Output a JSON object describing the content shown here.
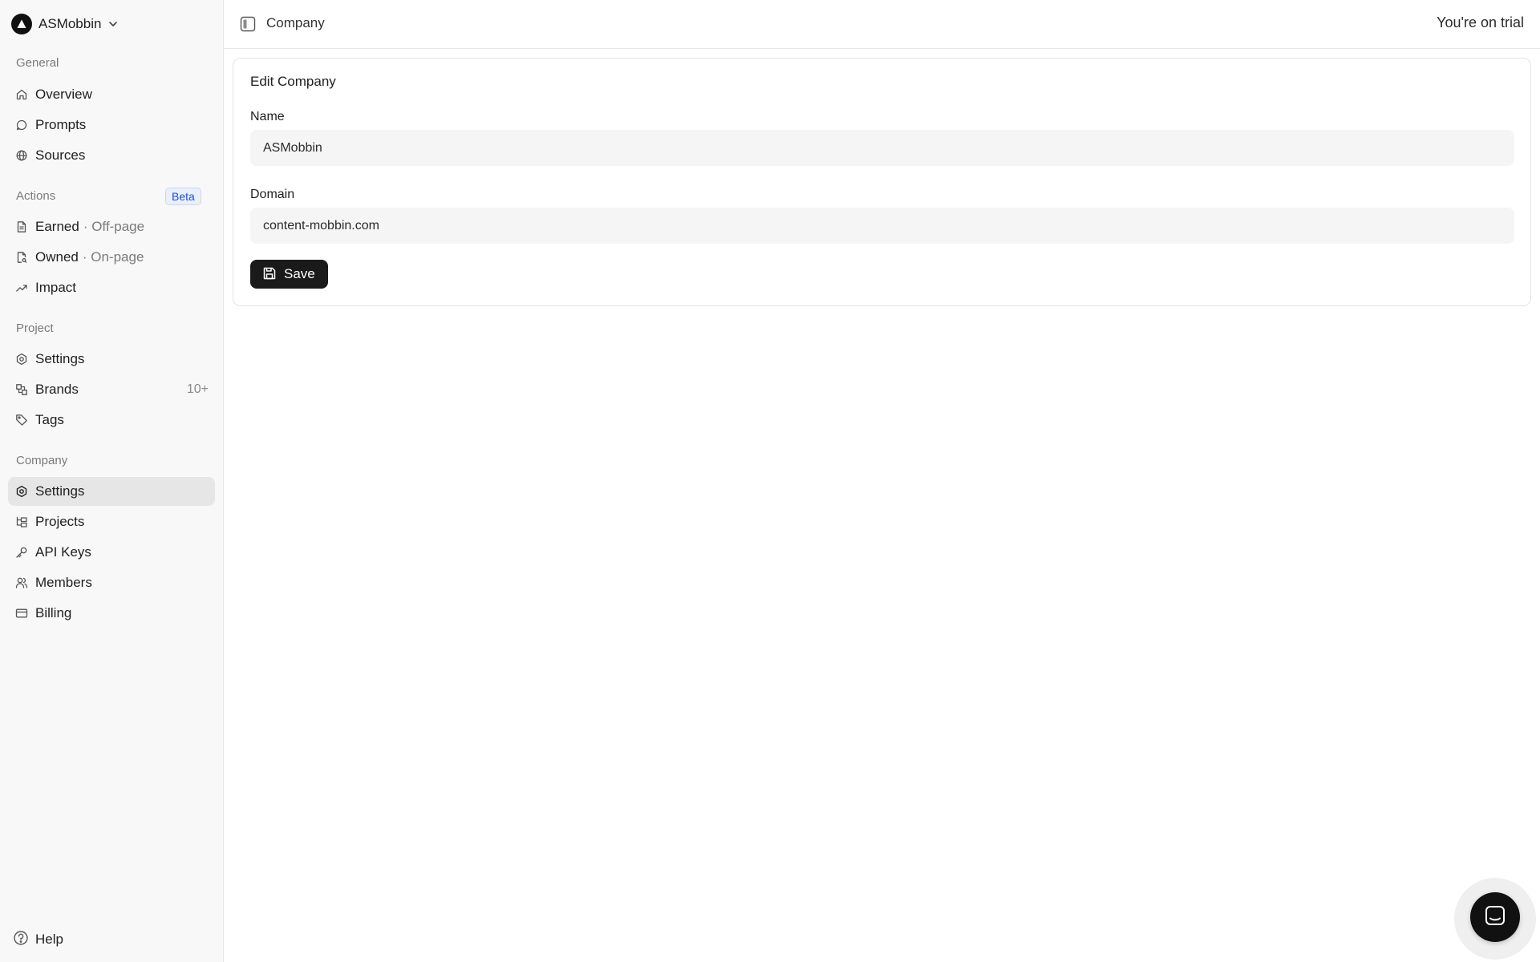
{
  "workspace": {
    "name": "ASMobbin"
  },
  "sidebar": {
    "groups": [
      {
        "label": "General",
        "items": [
          {
            "label": "Overview",
            "icon": "home-icon"
          },
          {
            "label": "Prompts",
            "icon": "message-circle-icon"
          },
          {
            "label": "Sources",
            "icon": "globe-icon"
          }
        ]
      },
      {
        "label": "Actions",
        "badge": "Beta",
        "items": [
          {
            "label": "Earned",
            "sub": "· Off-page",
            "icon": "file-text-icon"
          },
          {
            "label": "Owned",
            "sub": "· On-page",
            "icon": "file-search-icon"
          },
          {
            "label": "Impact",
            "icon": "trending-up-icon"
          }
        ]
      },
      {
        "label": "Project",
        "items": [
          {
            "label": "Settings",
            "icon": "gear-icon"
          },
          {
            "label": "Brands",
            "count": "10+",
            "icon": "shapes-icon"
          },
          {
            "label": "Tags",
            "icon": "tag-icon"
          }
        ]
      },
      {
        "label": "Company",
        "items": [
          {
            "label": "Settings",
            "icon": "gear-icon",
            "active": true
          },
          {
            "label": "Projects",
            "icon": "folder-tree-icon"
          },
          {
            "label": "API Keys",
            "icon": "key-icon"
          },
          {
            "label": "Members",
            "icon": "users-icon"
          },
          {
            "label": "Billing",
            "icon": "credit-card-icon"
          }
        ]
      }
    ],
    "help_label": "Help"
  },
  "topbar": {
    "breadcrumb": "Company",
    "trial_text": "You're on trial"
  },
  "form": {
    "title": "Edit Company",
    "name_label": "Name",
    "name_value": "ASMobbin",
    "domain_label": "Domain",
    "domain_value": "content-mobbin.com",
    "save_label": "Save"
  },
  "colors": {
    "sidebar_bg": "#f8f8f8",
    "active_item_bg": "#e6e6e6",
    "primary_button": "#1a1a1a",
    "beta_text": "#1d4ed8"
  }
}
